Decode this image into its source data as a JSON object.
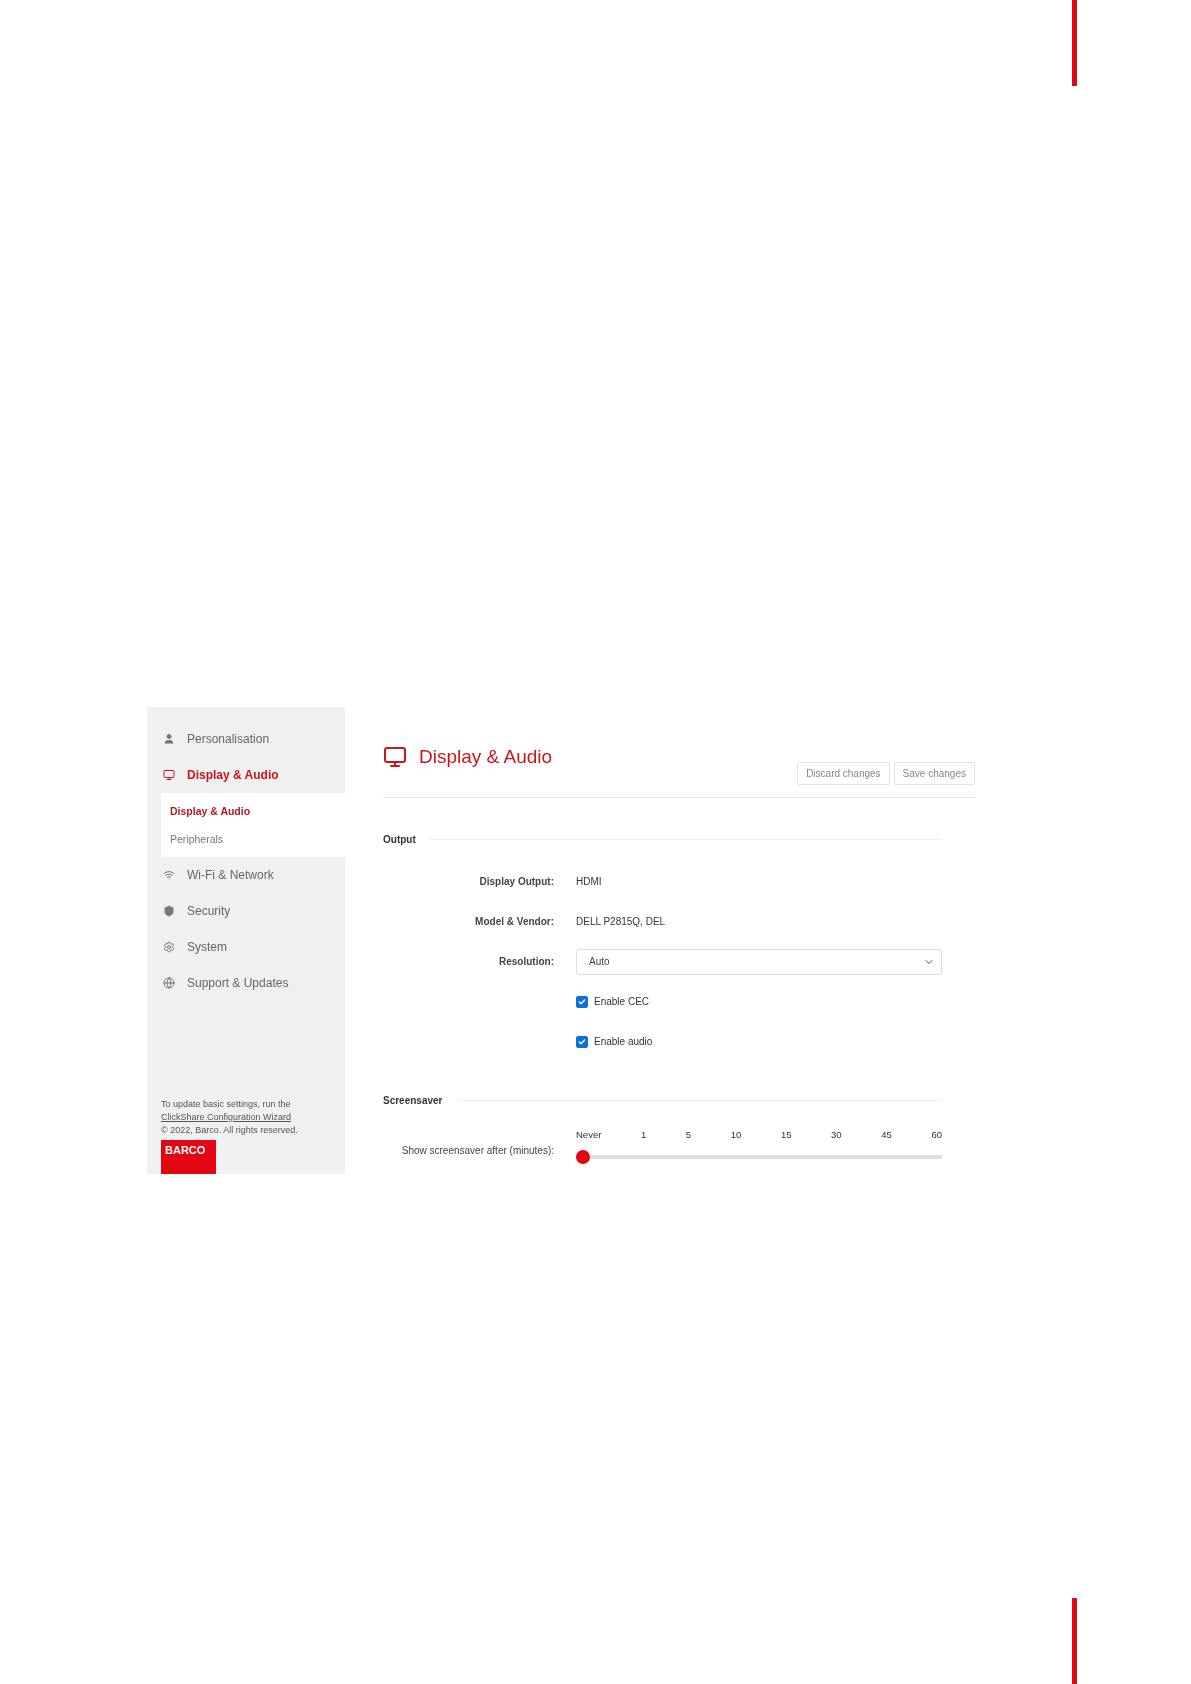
{
  "sidebar": {
    "items": [
      {
        "label": "Personalisation",
        "selected": false
      },
      {
        "label": "Display & Audio",
        "selected": true,
        "children": [
          {
            "label": "Display & Audio",
            "selected": true
          },
          {
            "label": "Peripherals",
            "selected": false
          }
        ]
      },
      {
        "label": "Wi-Fi & Network",
        "selected": false
      },
      {
        "label": "Security",
        "selected": false
      },
      {
        "label": "System",
        "selected": false
      },
      {
        "label": "Support & Updates",
        "selected": false
      }
    ],
    "footer": {
      "line_1": "To update basic settings, run the",
      "link": "ClickShare Configuration Wizard",
      "copyright": "© 2022, Barco. All rights reserved.",
      "logo": "BARCO"
    }
  },
  "main": {
    "title": "Display & Audio",
    "buttons": [
      "Discard changes",
      "Save changes"
    ],
    "sections": [
      {
        "title": "Output",
        "rows": [
          {
            "kind": "text",
            "label": "Display Output:",
            "value": "HDMI"
          },
          {
            "kind": "text",
            "label": "Model & Vendor:",
            "value": "DELL P2815Q, DEL"
          },
          {
            "kind": "select",
            "label": "Resolution:",
            "value": "Auto"
          },
          {
            "kind": "checkbox",
            "label": "Enable CEC",
            "checked": true
          },
          {
            "kind": "checkbox",
            "label": "Enable audio",
            "checked": true
          }
        ]
      },
      {
        "title": "Screensaver",
        "rows": [
          {
            "kind": "slider",
            "label": "Show screensaver after (minutes):",
            "ticks": [
              "Never",
              "1",
              "5",
              "10",
              "15",
              "30",
              "45",
              "60"
            ],
            "level": 0
          }
        ]
      }
    ]
  }
}
